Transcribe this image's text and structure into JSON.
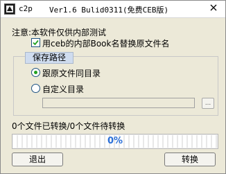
{
  "window": {
    "app_name": "c2p",
    "version_title": "Ver1.6 Bulid0311(免费CEB版)"
  },
  "notice": "注意:本软件仅供内部测试",
  "options": {
    "use_book_name": {
      "label": "用ceb的内部Book名替换原文件名",
      "checked": true
    }
  },
  "save_path": {
    "group_title": "保存路径",
    "options": [
      {
        "label": "跟原文件同目录",
        "selected": true
      },
      {
        "label": "自定义目录",
        "selected": false
      }
    ],
    "custom_dir_value": "",
    "browse_label": "..."
  },
  "status": "0个文件已转换/0个文件待转换",
  "progress": {
    "percent_text": "0%",
    "fraction": 0
  },
  "buttons": {
    "exit": "退出",
    "convert": "转换"
  },
  "colors": {
    "progress_text": "#2a6fd8",
    "radio_dot": "#21a121",
    "group_tab": "#cfdcef"
  }
}
